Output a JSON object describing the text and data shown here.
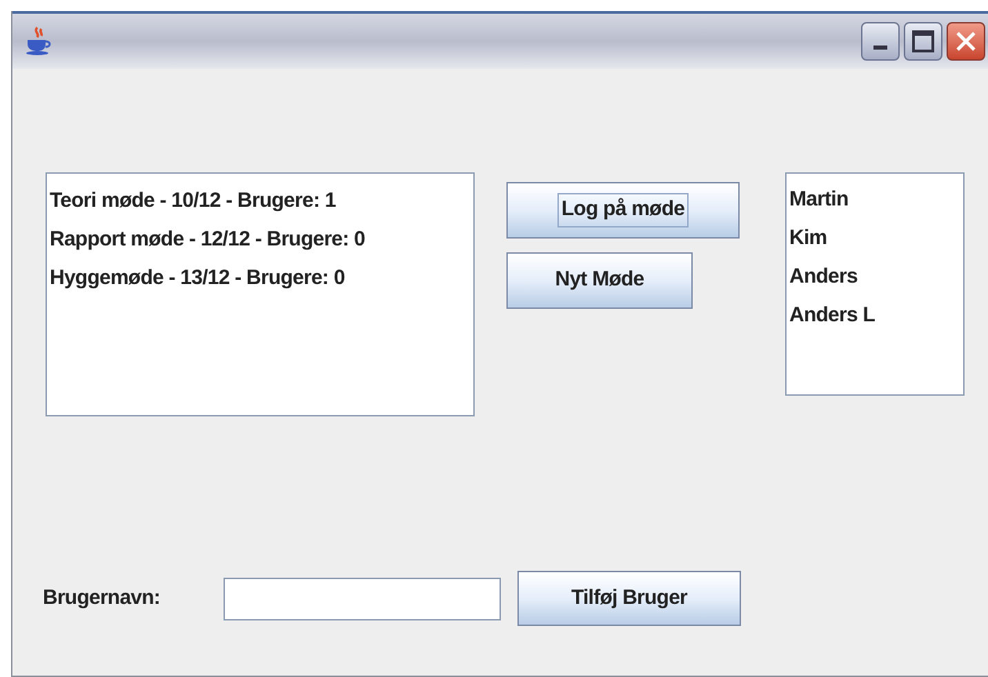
{
  "meetings": [
    "Teori møde - 10/12 - Brugere: 1",
    "Rapport møde - 12/12 - Brugere: 0",
    "Hyggemøde - 13/12 - Brugere: 0"
  ],
  "buttons": [
    {
      "label": "Log på møde",
      "focused": true
    },
    {
      "label": "Nyt Møde",
      "focused": false
    }
  ],
  "users": [
    "Martin",
    "Kim",
    "Anders",
    "Anders L"
  ],
  "username": {
    "label": "Brugernavn:",
    "button": "Tilføj Bruger"
  }
}
